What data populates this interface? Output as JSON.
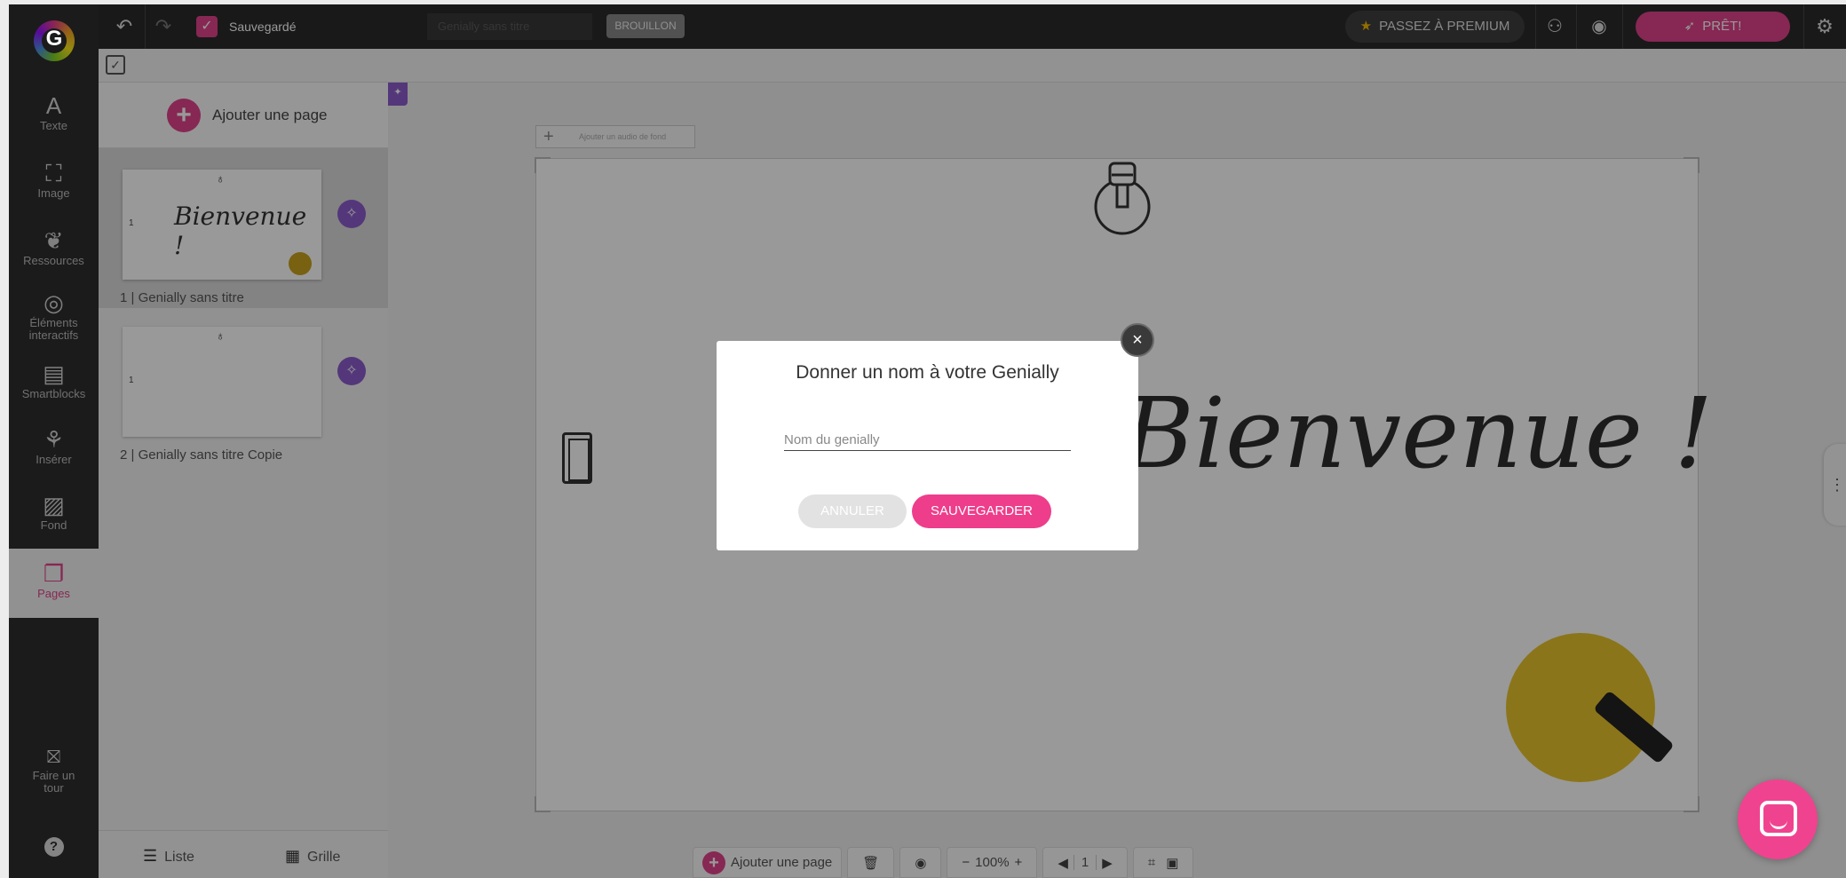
{
  "topbar": {
    "saved_label": "Sauvegardé",
    "title_placeholder": "Genially sans titre",
    "status_badge": "BROUILLON",
    "premium_label": "PASSEZ À PREMIUM",
    "ready_label": "PRÊT!"
  },
  "sidebar": {
    "items": [
      {
        "icon": "text-icon",
        "label": "Texte"
      },
      {
        "icon": "image-icon",
        "label": "Image"
      },
      {
        "icon": "resources-icon",
        "label": "Ressources"
      },
      {
        "icon": "interactive-elements-icon",
        "label": "Éléments interactifs"
      },
      {
        "icon": "smartblocks-icon",
        "label": "Smartblocks"
      },
      {
        "icon": "insert-icon",
        "label": "Insérer"
      },
      {
        "icon": "background-icon",
        "label": "Fond"
      },
      {
        "icon": "pages-icon",
        "label": "Pages"
      }
    ],
    "tour_label": "Faire un tour",
    "help": "?"
  },
  "pages_panel": {
    "add_page_label": "Ajouter une page",
    "pages": [
      {
        "number": "1",
        "title": "1 | Genially sans titre",
        "preview_text": "Bienvenue !"
      },
      {
        "number": "1",
        "title": "2 | Genially sans titre Copie",
        "preview_text": ""
      }
    ],
    "view_list": "Liste",
    "view_grid": "Grille"
  },
  "canvas": {
    "audio_label": "Ajouter un audio de fond",
    "big_text": "Bienvenue !"
  },
  "bottombar": {
    "add_page_label": "Ajouter une page",
    "zoom": "100%",
    "page_number": "1"
  },
  "modal": {
    "title": "Donner un nom à votre Genially",
    "input_placeholder": "Nom du genially",
    "cancel_label": "ANNULER",
    "save_label": "SAUVEGARDER",
    "close_symbol": "×"
  },
  "colors": {
    "accent": "#e0438a",
    "magic": "#8d5ccc",
    "yellow": "#e8c42e"
  }
}
